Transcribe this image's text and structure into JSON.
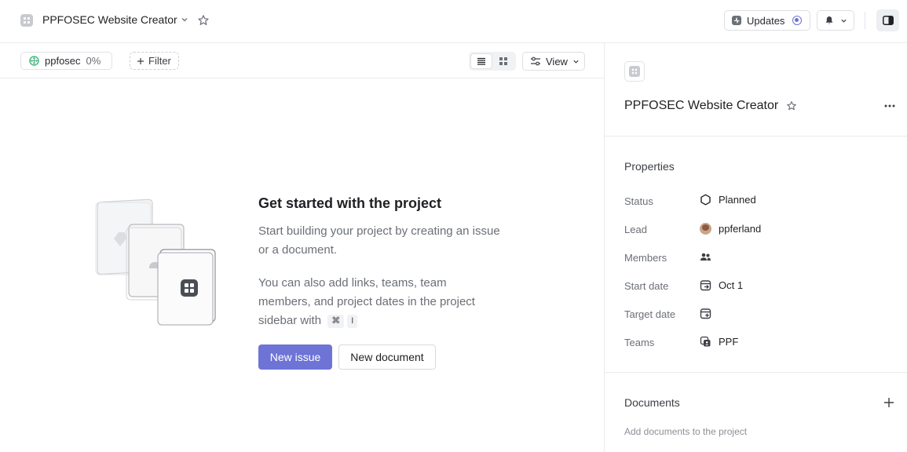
{
  "header": {
    "project_name": "PPFOSEC Website Creator",
    "updates_label": "Updates"
  },
  "filterbar": {
    "chip_name": "ppfosec",
    "chip_percent": "0%",
    "filter_label": "Filter",
    "view_label": "View"
  },
  "empty_state": {
    "title": "Get started with the project",
    "paragraph1": "Start building your project by creating an issue or a document.",
    "paragraph2": "You can also add links, teams, team members, and project dates in the project sidebar with",
    "shortcut_key1": "⌘",
    "shortcut_key2": "I",
    "primary_button": "New issue",
    "secondary_button": "New document"
  },
  "sidebar": {
    "title": "PPFOSEC Website Creator",
    "properties_heading": "Properties",
    "properties": {
      "status": {
        "label": "Status",
        "value": "Planned"
      },
      "lead": {
        "label": "Lead",
        "value": "ppferland"
      },
      "members": {
        "label": "Members",
        "value": ""
      },
      "start_date": {
        "label": "Start date",
        "value": "Oct 1"
      },
      "target_date": {
        "label": "Target date",
        "value": ""
      },
      "teams": {
        "label": "Teams",
        "value": "PPF"
      }
    },
    "documents_heading": "Documents",
    "documents_hint": "Add documents to the project"
  },
  "colors": {
    "accent": "#6e74d6",
    "progress_green": "#4cb782"
  },
  "icons": [
    "project-icon",
    "chevron-down-icon",
    "star-icon",
    "updates-icon",
    "bell-icon",
    "sidebar-toggle-icon",
    "plus-icon",
    "list-view-icon",
    "board-view-icon",
    "sliders-icon",
    "status-hexagon-icon",
    "members-icon",
    "calendar-start-icon",
    "calendar-add-icon",
    "team-icon",
    "more-icon"
  ]
}
